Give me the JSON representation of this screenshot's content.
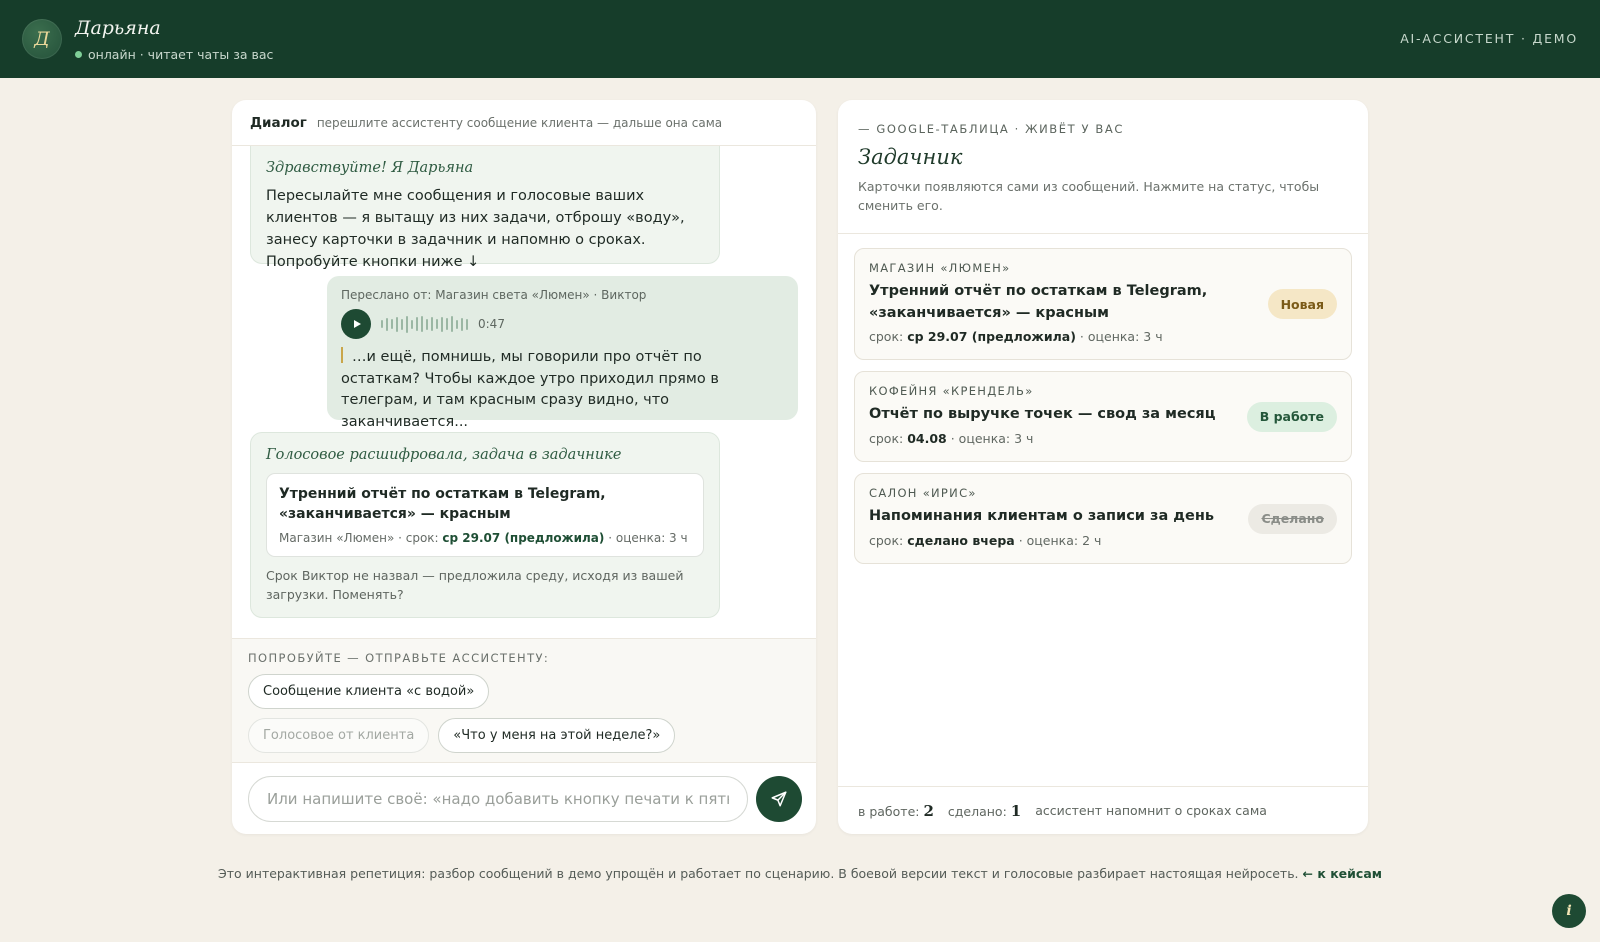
{
  "header": {
    "avatar_letter": "Д",
    "name": "Дарьяна",
    "status": "онлайн · читает чаты за вас",
    "right_label": "AI-АССИСТЕНТ · ДЕМО"
  },
  "chat": {
    "title": "Диалог",
    "subtitle": "перешлите ассистенту сообщение клиента — дальше она сама",
    "greeting": {
      "title": "Здравствуйте! Я Дарьяна",
      "text": "Пересылайте мне сообщения и голосовые ваших клиентов — я вытащу из них задачи, отброшу «воду», занесу карточки в задачник и напомню о сроках. Попробуйте кнопки ниже ↓"
    },
    "forwarded": {
      "from": "Переслано от: Магазин света «Люмен» · Виктор",
      "duration": "0:47",
      "waveform": [
        0.45,
        0.7,
        0.55,
        0.85,
        0.6,
        0.95,
        0.5,
        0.75,
        0.9,
        0.6,
        0.8,
        0.55,
        0.85,
        0.65,
        0.9,
        0.5,
        0.7,
        0.6
      ],
      "transcript": "…и ещё, помнишь, мы говорили про отчёт по остаткам? Чтобы каждое утро приходил прямо в телеграм, и там красным сразу видно, что заканчивается..."
    },
    "reply": {
      "title": "Голосовое расшифровала, задача в задачнике",
      "task_title": "Утренний отчёт по остаткам в Telegram, «заканчивается» — красным",
      "task_client": "Магазин «Люмен» · срок:",
      "task_deadline": "ср 29.07 (предложила)",
      "task_estimate": "· оценка: 3 ч",
      "note": "Срок Виктор не назвал — предложила среду, исходя из вашей загрузки. Поменять?"
    },
    "suggest_label": "ПОПРОБУЙТЕ — ОТПРАВЬТЕ АССИСТЕНТУ:",
    "chips": [
      "Сообщение клиента «с водой»",
      "Голосовое от клиента",
      "«Что у меня на этой неделе?»"
    ],
    "input_placeholder": "Или напишите своё: «надо добавить кнопку печати к пятнице»"
  },
  "board": {
    "kicker": "— GOOGLE-ТАБЛИЦА · ЖИВЁТ У ВАС",
    "title": "Задачник",
    "description": "Карточки появляются сами из сообщений. Нажмите на статус, чтобы сменить его.",
    "cards": [
      {
        "client": "МАГАЗИН «ЛЮМЕН»",
        "title": "Утренний отчёт по остаткам в Telegram, «заканчивается» — красным",
        "deadline_label": "срок:",
        "deadline": "ср 29.07 (предложила)",
        "estimate": "· оценка: 3 ч",
        "status": "Новая"
      },
      {
        "client": "КОФЕЙНЯ «КРЕНДЕЛЬ»",
        "title": "Отчёт по выручке точек — свод за месяц",
        "deadline_label": "срок:",
        "deadline": "04.08",
        "estimate": "· оценка: 3 ч",
        "status": "В работе"
      },
      {
        "client": "САЛОН «ИРИС»",
        "title": "Напоминания клиентам о записи за день",
        "deadline_label": "срок:",
        "deadline": "сделано вчера",
        "estimate": "· оценка: 2 ч",
        "status": "Сделано"
      }
    ],
    "footer": {
      "in_work_label": "в работе:",
      "in_work_count": "2",
      "done_label": "сделано:",
      "done_count": "1",
      "note": "ассистент напомнит о сроках сама"
    }
  },
  "footer": {
    "text": "Это интерактивная репетиция: разбор сообщений в демо упрощён и работает по сценарию. В боевой версии текст и голосовые разбирает настоящая нейросеть.",
    "link": "← к кейсам"
  },
  "info_button": "i",
  "colors": {
    "header_bg": "#163d2a",
    "accent": "#1e4a33",
    "page_bg": "#f4f0e8",
    "status_new": "#f5e7c6",
    "status_work": "#dcefe0",
    "status_done": "#eceae4"
  }
}
